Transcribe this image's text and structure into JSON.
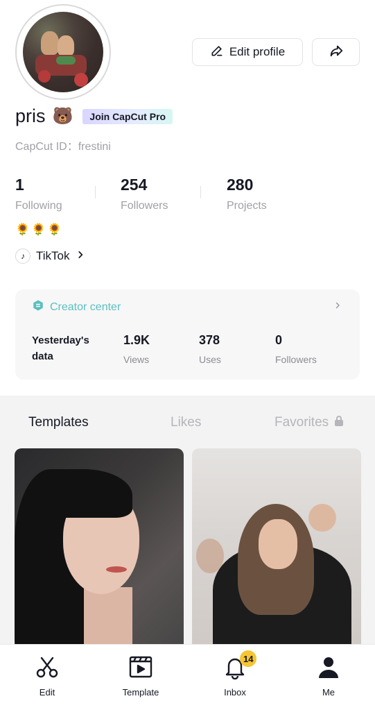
{
  "profile": {
    "username": "pris",
    "emoji": "🐻",
    "pro_badge": "Join CapCut Pro",
    "capcut_id": "CapCut ID：frestini",
    "bio_emojis": "🌻🌻🌻",
    "tiktok_link": "TikTok"
  },
  "actions": {
    "edit_profile": "Edit profile"
  },
  "stats": [
    {
      "value": "1",
      "label": "Following"
    },
    {
      "value": "254",
      "label": "Followers"
    },
    {
      "value": "280",
      "label": "Projects"
    }
  ],
  "creator_center": {
    "title": "Creator center",
    "period_label_line1": "Yesterday's",
    "period_label_line2": "data",
    "metrics": [
      {
        "value": "1.9K",
        "label": "Views"
      },
      {
        "value": "378",
        "label": "Uses"
      },
      {
        "value": "0",
        "label": "Followers"
      }
    ]
  },
  "tabs": [
    {
      "label": "Templates",
      "active": true
    },
    {
      "label": "Likes",
      "active": false
    },
    {
      "label": "Favorites",
      "active": false,
      "locked": true
    }
  ],
  "bottom_nav": [
    {
      "label": "Edit",
      "icon": "scissors-icon"
    },
    {
      "label": "Template",
      "icon": "template-icon"
    },
    {
      "label": "Inbox",
      "icon": "bell-icon",
      "badge": "14"
    },
    {
      "label": "Me",
      "icon": "person-icon",
      "active": true
    }
  ],
  "colors": {
    "accent_teal": "#5bbfbf",
    "badge_yellow": "#f6c533",
    "text_primary": "#161823",
    "text_secondary": "#a0a0a6"
  }
}
